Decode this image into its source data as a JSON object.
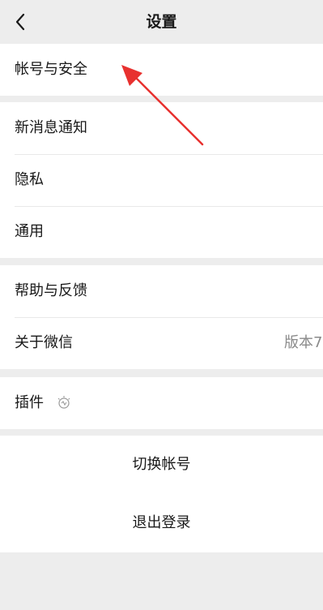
{
  "header": {
    "title": "设置",
    "back_icon": "chevron-left-icon"
  },
  "groups": [
    {
      "items": [
        {
          "label": "帐号与安全"
        }
      ]
    },
    {
      "items": [
        {
          "label": "新消息通知"
        },
        {
          "label": "隐私"
        },
        {
          "label": "通用"
        }
      ]
    },
    {
      "items": [
        {
          "label": "帮助与反馈"
        },
        {
          "label": "关于微信",
          "value": "版本7"
        }
      ]
    },
    {
      "items": [
        {
          "label": "插件",
          "icon": "lightbulb-icon"
        }
      ]
    }
  ],
  "actions": {
    "switch_account": "切换帐号",
    "logout": "退出登录"
  },
  "colors": {
    "background": "#ededed",
    "cell": "#ffffff",
    "annotation_arrow": "#e8312f"
  }
}
